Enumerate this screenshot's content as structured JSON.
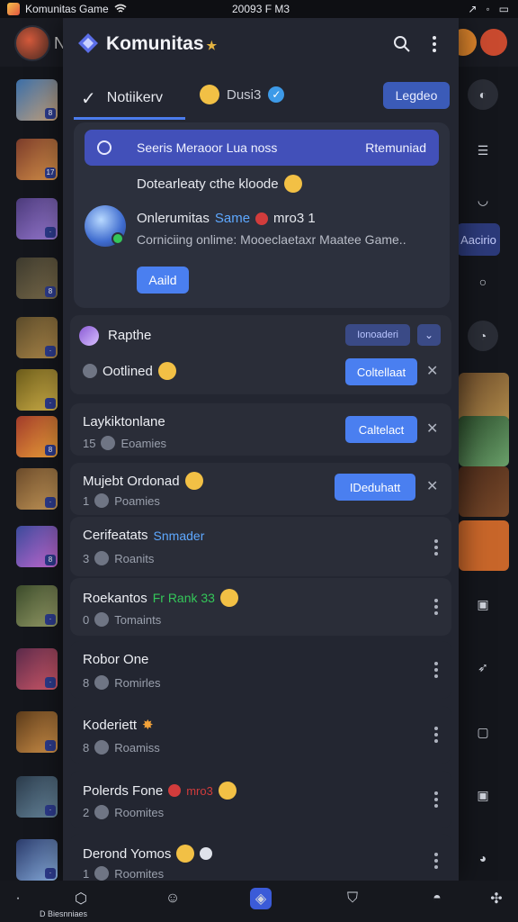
{
  "status_bar": {
    "app": "Komunitas Game",
    "time": "20093 F M3"
  },
  "background": {
    "header_initial": "N"
  },
  "panel": {
    "title": "Komunitas",
    "tabs": [
      {
        "label": "Notiikerv"
      },
      {
        "label": "Dusi3"
      }
    ],
    "legend_button": "Legdeo"
  },
  "card": {
    "banner_left": "Seeris Meraoor Lua noss",
    "banner_right": "Rtemuniad",
    "line2": "Dotearleaty cthe kloode",
    "online_title": "Onlerumitas",
    "online_same": "Same",
    "online_extra": "mro3 1",
    "online_sub": "Corniciing onlime: Mooeclaetaxr Maatee Game..",
    "add_button": "Aaild"
  },
  "rows": [
    {
      "name": "Rapthe",
      "badge": "Ionoaderi",
      "sub": "Ootlined",
      "button": "Coltellaat"
    },
    {
      "name": "Laykiktonlane",
      "sub_count": "15",
      "sub": "Eoamies",
      "button": "Caltelact"
    },
    {
      "name": "Mujebt Ordonad",
      "sub_count": "1",
      "sub": "Poamies",
      "button": "IDeduhatt"
    },
    {
      "name": "Cerifeatats",
      "tag": "Snmader",
      "sub_count": "3",
      "sub": "Roanits"
    },
    {
      "name": "Roekantos",
      "tag": "Fr Rank 33",
      "sub_count": "0",
      "sub": "Tomaints"
    },
    {
      "name": "Robor One",
      "sub_count": "8",
      "sub": "Romirles"
    },
    {
      "name": "Koderiett",
      "sub_count": "8",
      "sub": "Roamiss"
    },
    {
      "name": "Polerds Fone",
      "tag": "mro3",
      "sub_count": "2",
      "sub": "Roomites"
    },
    {
      "name": "Derond Yomos",
      "sub_count": "1",
      "sub": "Roomites"
    }
  ],
  "right_col": {
    "label": "Aacirio"
  },
  "bottom_nav": {
    "label": "D Biesnniaes"
  },
  "colors": {
    "accent": "#4a7ff0",
    "banner": "#4250b9",
    "panel": "#232631",
    "row": "#2a2d38"
  }
}
